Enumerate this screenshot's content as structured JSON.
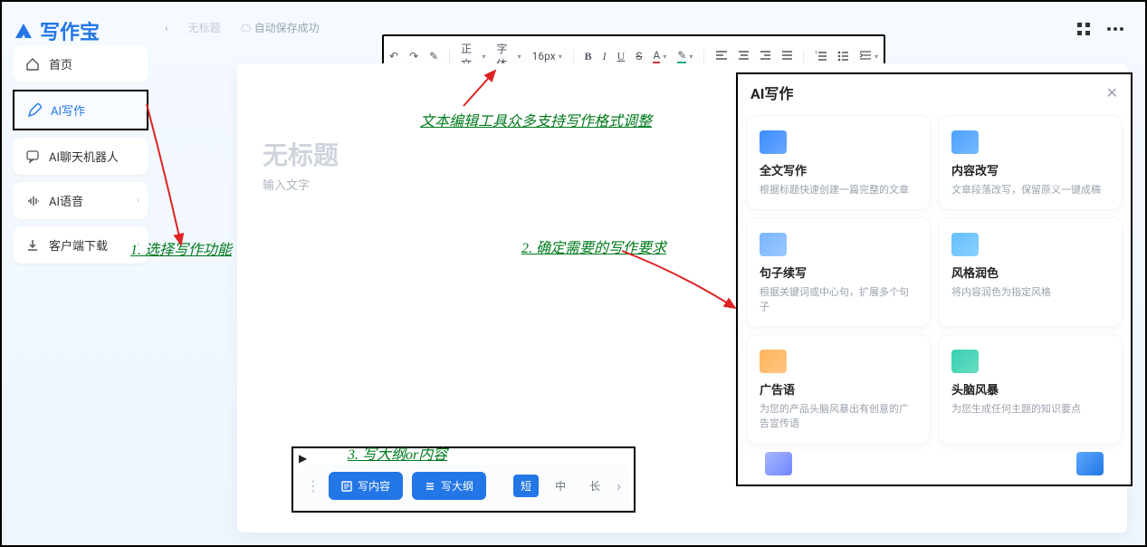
{
  "app": {
    "name": "写作宝"
  },
  "crumb": {
    "back": "‹",
    "tab": "无标题",
    "autosave_icon": "☁",
    "autosave": "自动保存成功"
  },
  "top": {
    "grid_icon": "grid",
    "more_icon": "more"
  },
  "sidebar": {
    "items": [
      {
        "icon": "home",
        "label": "首页",
        "active": false
      },
      {
        "icon": "pencil",
        "label": "AI写作",
        "active": true
      },
      {
        "icon": "chat",
        "label": "AI聊天机器人",
        "active": false
      },
      {
        "icon": "voice",
        "label": "AI语音",
        "active": false,
        "chev": true
      },
      {
        "icon": "download",
        "label": "客户端下载",
        "active": false,
        "chev": true
      }
    ]
  },
  "toolbar": {
    "undo": "↶",
    "redo": "↷",
    "brush": "✎",
    "para": "正文",
    "font": "字体",
    "size": "16px",
    "bold": "B",
    "italic": "I",
    "underline": "U",
    "strike": "S",
    "color": "A",
    "highlight": "✎"
  },
  "editor": {
    "title_placeholder": "无标题",
    "body_placeholder": "输入文字"
  },
  "compose": {
    "write_content": "写内容",
    "write_outline": "写大纲",
    "len_short": "短",
    "len_mid": "中",
    "len_long": "长"
  },
  "ai_panel": {
    "title": "AI写作",
    "cards": [
      {
        "title": "全文写作",
        "desc": "根据标题快速创建一篇完整的文章",
        "ic": "#3a8bff"
      },
      {
        "title": "内容改写",
        "desc": "文章段落改写，保留原义一键成稿",
        "ic": "#4aa1ff"
      },
      {
        "title": "句子续写",
        "desc": "根据关键词或中心句，扩展多个句子",
        "ic": "#7ab5ff"
      },
      {
        "title": "风格润色",
        "desc": "将内容润色为指定风格",
        "ic": "#63c0ff"
      },
      {
        "title": "广告语",
        "desc": "为您的产品头脑风暴出有创意的广告宣传语",
        "ic": "#ffb35c"
      },
      {
        "title": "头脑风暴",
        "desc": "为您生成任何主题的知识要点",
        "ic": "#36d0b0"
      }
    ],
    "bottom_icons": [
      "#8c9dff",
      "#3a8bff"
    ]
  },
  "annotations": {
    "a1": "1. 选择写作功能",
    "a2": "2. 确定需要的写作要求",
    "a3": "3. 写大纲or内容",
    "a_toolbar": "文本编辑工具众多支持写作格式调整"
  }
}
